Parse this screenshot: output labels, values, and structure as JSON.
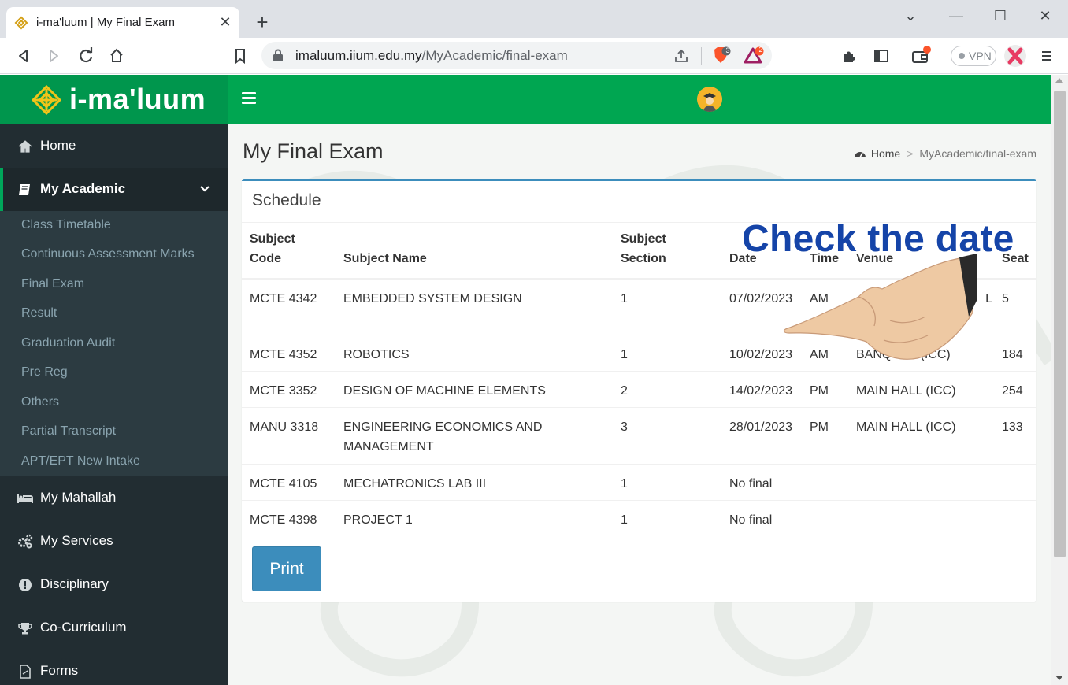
{
  "browser": {
    "tab_title": "i-ma'luum | My Final Exam",
    "tab_close": "✕",
    "new_tab": "+",
    "url_host": "imaluum.iium.edu.my",
    "url_path": "/MyAcademic/final-exam",
    "vpn_label": "VPN",
    "brave_badge": "3",
    "rewards_badge": "2",
    "window_controls": {
      "minimize": "—",
      "maximize": "☐",
      "close": "✕",
      "tabsearch": "⌄"
    }
  },
  "brand": {
    "name": "i-ma'luum",
    "primary_color": "#00a651",
    "sidebar_color": "#222d32",
    "accent_color": "#3c8dbc"
  },
  "sidebar": {
    "items": [
      {
        "label": "Home",
        "icon": "home-icon"
      },
      {
        "label": "My Academic",
        "icon": "book-icon",
        "active": true,
        "expanded": true
      },
      {
        "label": "My Mahallah",
        "icon": "bed-icon"
      },
      {
        "label": "My Services",
        "icon": "cogs-icon"
      },
      {
        "label": "Disciplinary",
        "icon": "exclamation-circle-icon"
      },
      {
        "label": "Co-Curriculum",
        "icon": "trophy-icon"
      },
      {
        "label": "Forms",
        "icon": "file-icon"
      }
    ],
    "submenu": [
      "Class Timetable",
      "Continuous Assessment Marks",
      "Final Exam",
      "Result",
      "Graduation Audit",
      "Pre Reg",
      "Others",
      "Partial Transcript",
      "APT/EPT New Intake"
    ]
  },
  "page": {
    "title": "My Final Exam",
    "breadcrumb": {
      "home": "Home",
      "separator": ">",
      "current": "MyAcademic/final-exam"
    }
  },
  "schedule": {
    "title": "Schedule",
    "headers": {
      "code_1": "Subject",
      "code_2": "Code",
      "name": "Subject Name",
      "section_1": "Subject",
      "section_2": "Section",
      "date": "Date",
      "time": "Time",
      "venue": "Venue",
      "seat": "Seat"
    },
    "rows": [
      {
        "code": "MCTE 4342",
        "name": "EMBEDDED SYSTEM DESIGN",
        "section": "1",
        "date": "07/02/2023",
        "time": "AM",
        "venue": "L",
        "seat": "5"
      },
      {
        "code": "MCTE 4352",
        "name": "ROBOTICS",
        "section": "1",
        "date": "10/02/2023",
        "time": "AM",
        "venue": "BANQUET (ICC)",
        "seat": "184"
      },
      {
        "code": "MCTE 3352",
        "name": "DESIGN OF MACHINE ELEMENTS",
        "section": "2",
        "date": "14/02/2023",
        "time": "PM",
        "venue": "MAIN HALL (ICC)",
        "seat": "254"
      },
      {
        "code": "MANU 3318",
        "name": "ENGINEERING ECONOMICS AND MANAGEMENT",
        "section": "3",
        "date": "28/01/2023",
        "time": "PM",
        "venue": "MAIN HALL (ICC)",
        "seat": "133"
      },
      {
        "code": "MCTE 4105",
        "name": "MECHATRONICS LAB III",
        "section": "1",
        "date": "No final",
        "time": "",
        "venue": "",
        "seat": ""
      },
      {
        "code": "MCTE 4398",
        "name": "PROJECT 1",
        "section": "1",
        "date": "No final",
        "time": "",
        "venue": "",
        "seat": ""
      }
    ],
    "print_label": "Print"
  },
  "annotation": {
    "text": "Check the date",
    "color": "#1544a8"
  }
}
